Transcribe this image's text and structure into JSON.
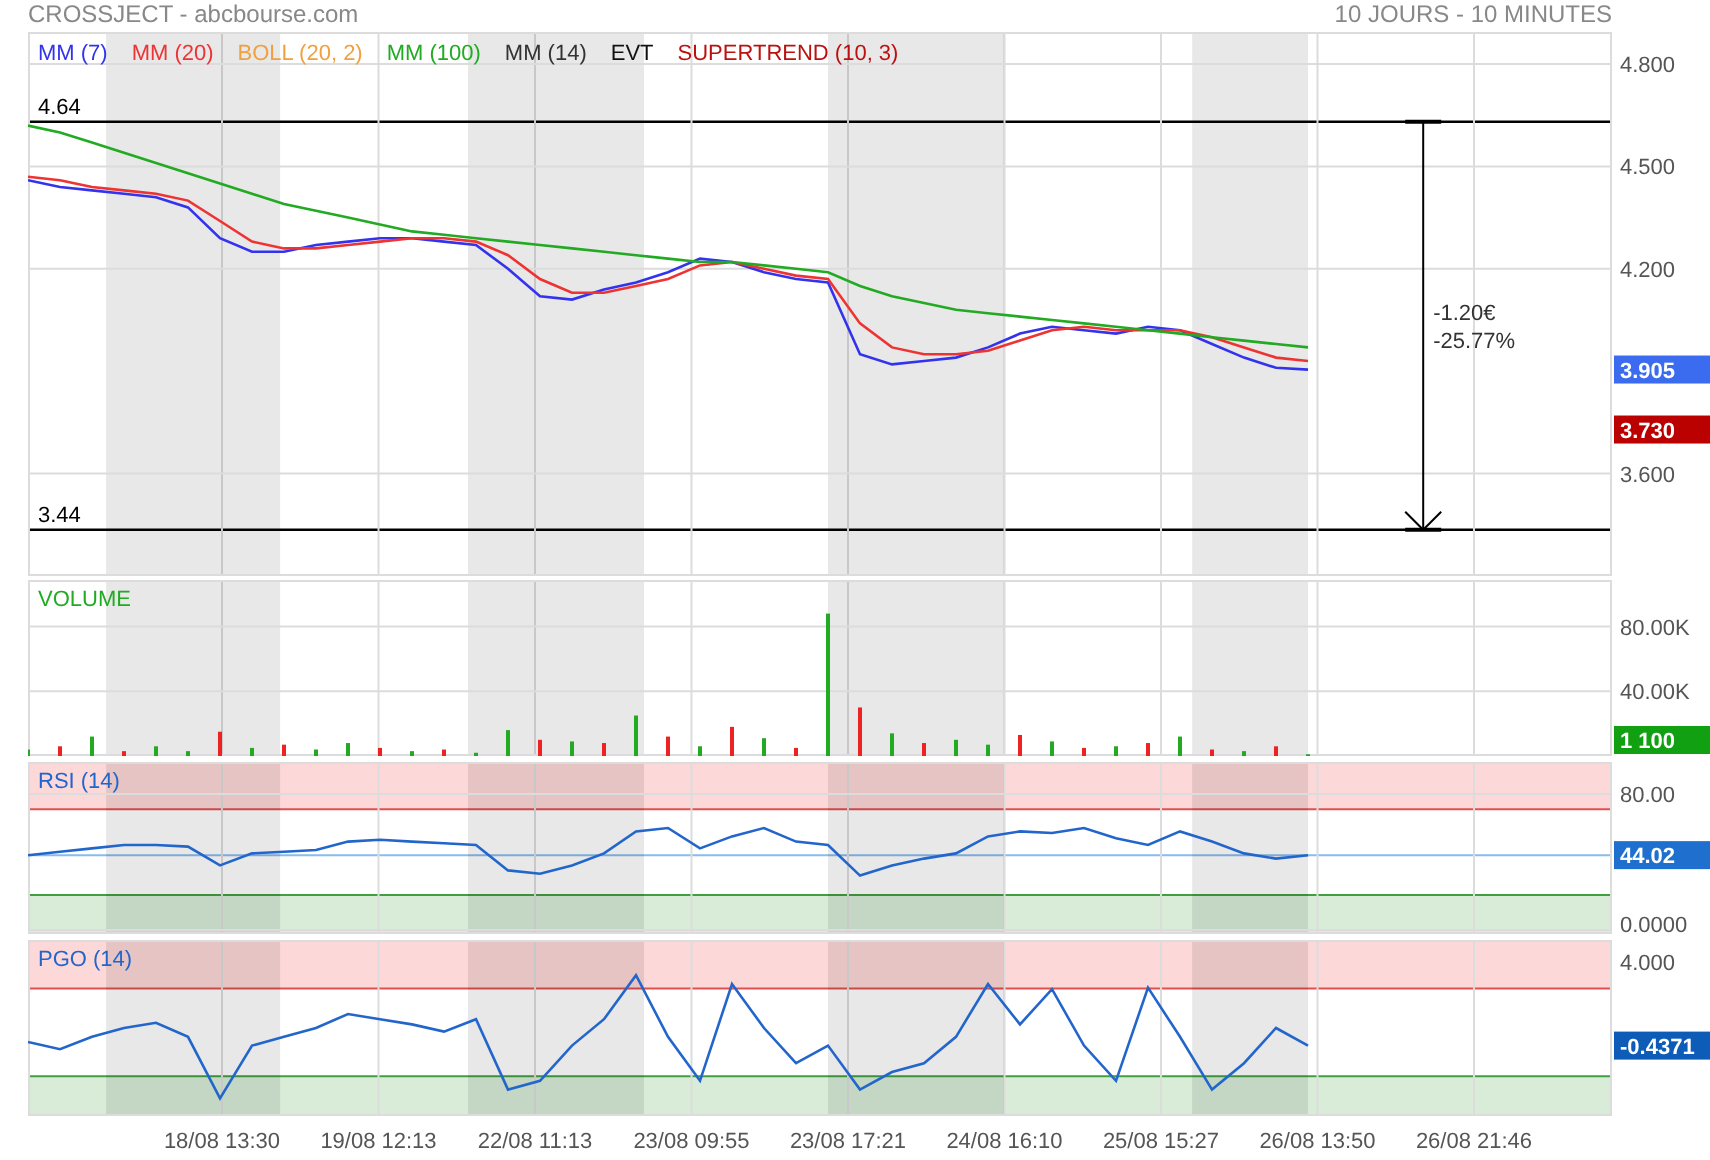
{
  "header": {
    "title": "CROSSJECT - abcbourse.com",
    "period": "10 JOURS - 10 MINUTES"
  },
  "legend": [
    {
      "label": "MM (7)",
      "color": "#3333ee"
    },
    {
      "label": "MM (20)",
      "color": "#ee3333"
    },
    {
      "label": "BOLL (20, 2)",
      "color": "#f0a040"
    },
    {
      "label": "MM (100)",
      "color": "#22aa22"
    },
    {
      "label": "MM (14)",
      "color": "#333333"
    },
    {
      "label": "EVT",
      "color": "#111111"
    },
    {
      "label": "SUPERTREND (10, 3)",
      "color": "#bb1111"
    }
  ],
  "panels": [
    {
      "kind": "price",
      "chart_data": {
        "type": "line",
        "grid": true,
        "ylim": [
          3.3,
          4.894
        ],
        "categories": [
          null,
          null,
          null,
          null,
          null,
          null,
          null,
          null,
          null,
          null,
          null,
          null,
          null,
          null,
          null,
          null,
          null,
          null,
          null,
          null,
          null,
          null,
          null,
          null,
          null,
          null,
          null,
          null,
          null,
          null,
          null,
          null,
          null,
          null,
          null,
          null,
          null,
          null,
          null,
          null,
          null,
          null,
          null,
          null,
          null,
          null,
          null,
          null,
          null,
          null
        ],
        "yticks": [
          {
            "value": 3.6,
            "label": "3.600"
          },
          {
            "value": 4.2,
            "label": "4.200"
          },
          {
            "value": 4.5,
            "label": "4.500"
          },
          {
            "value": 4.8,
            "label": "4.800"
          }
        ],
        "series": [
          {
            "color": "#3333ee",
            "values": [
              4.46,
              4.44,
              4.43,
              4.42,
              4.41,
              4.38,
              4.29,
              4.25,
              4.25,
              4.27,
              4.28,
              4.29,
              4.29,
              4.28,
              4.27,
              4.2,
              4.12,
              4.11,
              4.14,
              4.16,
              4.19,
              4.23,
              4.22,
              4.19,
              4.17,
              4.16,
              3.95,
              3.92,
              3.93,
              3.94,
              3.97,
              4.01,
              4.03,
              4.02,
              4.01,
              4.03,
              4.02,
              3.98,
              3.94,
              3.91,
              3.905,
              null,
              null,
              null,
              null,
              null,
              null,
              null,
              null,
              null
            ]
          },
          {
            "color": "#ee3333",
            "values": [
              4.47,
              4.46,
              4.44,
              4.43,
              4.42,
              4.4,
              4.34,
              4.28,
              4.26,
              4.26,
              4.27,
              4.28,
              4.29,
              4.29,
              4.28,
              4.24,
              4.17,
              4.13,
              4.13,
              4.15,
              4.17,
              4.21,
              4.22,
              4.2,
              4.18,
              4.17,
              4.04,
              3.97,
              3.95,
              3.95,
              3.96,
              3.99,
              4.02,
              4.03,
              4.02,
              4.02,
              4.02,
              4.0,
              3.97,
              3.94,
              3.93,
              null,
              null,
              null,
              null,
              null,
              null,
              null,
              null,
              null
            ]
          },
          {
            "color": "#22aa22",
            "values": [
              4.62,
              4.6,
              4.57,
              4.54,
              4.51,
              4.48,
              4.45,
              4.42,
              4.39,
              4.37,
              4.35,
              4.33,
              4.31,
              4.3,
              4.29,
              4.28,
              4.27,
              4.26,
              4.25,
              4.24,
              4.23,
              4.22,
              4.22,
              4.21,
              4.2,
              4.19,
              4.15,
              4.12,
              4.1,
              4.08,
              4.07,
              4.06,
              4.05,
              4.04,
              4.03,
              4.02,
              4.01,
              4.0,
              3.99,
              3.98,
              3.97,
              null,
              null,
              null,
              null,
              null,
              null,
              null,
              null,
              null
            ]
          }
        ]
      },
      "levels": [
        {
          "label": "4.64"
        },
        {
          "label": "3.44"
        }
      ],
      "measure": {
        "lines": [
          "-1.20€",
          "-25.77%"
        ]
      },
      "badges": [
        {
          "label": "3.905",
          "color": "#3b6cf0"
        },
        {
          "label": "3.730",
          "color": "#bb0000"
        }
      ]
    },
    {
      "kind": "volume",
      "chart_data": {
        "type": "bar",
        "title": "VOLUME",
        "grid": true,
        "stacked": true,
        "ylim": [
          0,
          108750
        ],
        "categories": [
          null,
          null,
          null,
          null,
          null,
          null,
          null,
          null,
          null,
          null,
          null,
          null,
          null,
          null,
          null,
          null,
          null,
          null,
          null,
          null,
          null,
          null,
          null,
          null,
          null,
          null,
          null,
          null,
          null,
          null,
          null,
          null,
          null,
          null,
          null,
          null,
          null,
          null,
          null,
          null,
          null,
          null,
          null,
          null,
          null,
          null,
          null,
          null,
          null,
          null
        ],
        "yticks": [
          {
            "value": 40000,
            "label": "40.00K"
          },
          {
            "value": 80000,
            "label": "80.00K"
          }
        ],
        "series": [
          {
            "color": "#22aa22",
            "values": [
              4000,
              null,
              12000,
              null,
              6000,
              3000,
              null,
              5000,
              null,
              4000,
              8000,
              null,
              3000,
              null,
              2000,
              16000,
              null,
              9000,
              null,
              25000,
              null,
              6000,
              null,
              11000,
              null,
              88000,
              null,
              14000,
              null,
              10000,
              7000,
              null,
              9000,
              null,
              6000,
              null,
              12000,
              null,
              3000,
              null,
              1100,
              null,
              null,
              null,
              null,
              null,
              null,
              null,
              null,
              null
            ]
          },
          {
            "color": "#ee2222",
            "values": [
              null,
              6000,
              null,
              3000,
              null,
              null,
              15000,
              null,
              7000,
              null,
              null,
              5000,
              null,
              4000,
              null,
              null,
              10000,
              null,
              8000,
              null,
              12000,
              null,
              18000,
              null,
              5000,
              null,
              30000,
              null,
              8000,
              null,
              null,
              13000,
              null,
              5000,
              null,
              8000,
              null,
              4000,
              null,
              6000,
              null,
              null,
              null,
              null,
              null,
              null,
              null,
              null,
              null,
              null
            ]
          }
        ]
      },
      "badges": [
        {
          "label": "1 100",
          "color": "#11a011"
        }
      ]
    },
    {
      "kind": "oscillator",
      "chart_data": {
        "type": "line",
        "title": "RSI (14)",
        "grid": true,
        "ylim": [
          -2.4,
          98.8
        ],
        "categories": [
          null,
          null,
          null,
          null,
          null,
          null,
          null,
          null,
          null,
          null,
          null,
          null,
          null,
          null,
          null,
          null,
          null,
          null,
          null,
          null,
          null,
          null,
          null,
          null,
          null,
          null,
          null,
          null,
          null,
          null,
          null,
          null,
          null,
          null,
          null,
          null,
          null,
          null,
          null,
          null,
          null,
          null,
          null,
          null,
          null,
          null,
          null,
          null,
          null,
          null
        ],
        "yticks": [
          {
            "value": 0,
            "label": "0.0000"
          },
          {
            "value": 80,
            "label": "80.00"
          }
        ],
        "series": [
          {
            "color": "#2266cc",
            "values": [
              44,
              46,
              48,
              50,
              50,
              49,
              38,
              45,
              46,
              47,
              52,
              53,
              52,
              51,
              50,
              35,
              33,
              38,
              45,
              58,
              60,
              48,
              55,
              60,
              52,
              50,
              32,
              38,
              42,
              45,
              55,
              58,
              57,
              60,
              54,
              50,
              58,
              52,
              45,
              42,
              44,
              null,
              null,
              null,
              null,
              null,
              null,
              null,
              null,
              null
            ]
          }
        ]
      },
      "badges": [
        {
          "label": "44.02",
          "color": "#1f6fcf"
        }
      ]
    },
    {
      "kind": "oscillator",
      "title": "PGO (14)",
      "time_axis": [
        "18/08 13:30",
        "19/08 12:13",
        "22/08 11:13",
        "23/08 09:55",
        "23/08 17:21",
        "24/08 16:10",
        "25/08 15:27",
        "26/08 13:50",
        "26/08 21:46"
      ],
      "axis_label": "4.000",
      "badges": [
        {
          "label": "-0.4371",
          "color": "#0d5cb8"
        }
      ]
    }
  ]
}
